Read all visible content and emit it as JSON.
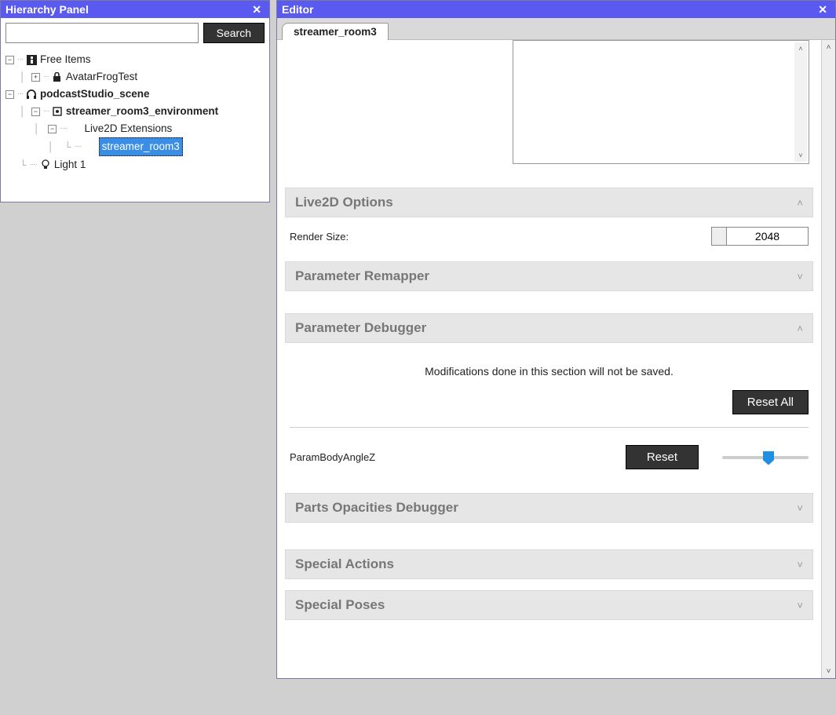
{
  "hierarchy": {
    "title": "Hierarchy Panel",
    "search_placeholder": "",
    "search_button": "Search",
    "nodes": {
      "free_items": "Free Items",
      "avatar_frog": "AvatarFrogTest",
      "podcast_scene": "podcastStudio_scene",
      "streamer_env": "streamer_room3_environment",
      "live2d_ext": "Live2D Extensions",
      "streamer_room3": "streamer_room3",
      "light1": "Light 1"
    }
  },
  "editor": {
    "title": "Editor",
    "tab_label": "streamer_room3",
    "sections": {
      "live2d_options": {
        "title": "Live2D Options",
        "render_size_label": "Render Size:",
        "render_size_value": "2048"
      },
      "param_remapper": {
        "title": "Parameter Remapper"
      },
      "param_debugger": {
        "title": "Parameter Debugger",
        "info": "Modifications done in this section will not be saved.",
        "reset_all": "Reset All",
        "param_name": "ParamBodyAngleZ",
        "reset_btn": "Reset"
      },
      "parts_opacity": {
        "title": "Parts Opacities Debugger"
      },
      "special_actions": {
        "title": "Special Actions"
      },
      "special_poses": {
        "title": "Special Poses"
      }
    }
  }
}
